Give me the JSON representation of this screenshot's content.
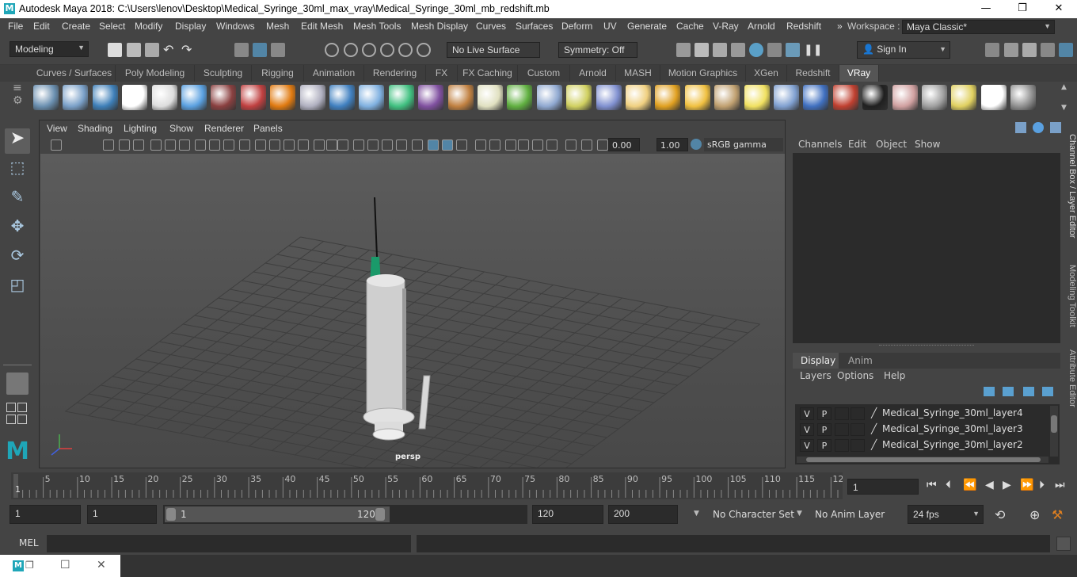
{
  "window": {
    "title": "Autodesk Maya 2018: C:\\Users\\lenov\\Desktop\\Medical_Syringe_30ml_max_vray\\Medical_Syringe_30ml_mb_redshift.mb",
    "logo": "M",
    "minimize": "—",
    "maximize": "❐",
    "close": "✕"
  },
  "menubar": {
    "items": [
      "File",
      "Edit",
      "Create",
      "Select",
      "Modify",
      "Display",
      "Windows",
      "Mesh",
      "Edit Mesh",
      "Mesh Tools",
      "Mesh Display",
      "Curves",
      "Surfaces",
      "Deform",
      "UV",
      "Generate",
      "Cache",
      "V-Ray",
      "Arnold",
      "Redshift"
    ],
    "more": "»",
    "workspace_label": "Workspace :",
    "workspace_value": "Maya Classic*"
  },
  "statusline": {
    "mode": "Modeling",
    "live_surface": "No Live Surface",
    "symmetry": "Symmetry: Off",
    "sign_in": "Sign In"
  },
  "shelf": {
    "tabs": [
      "Curves / Surfaces",
      "Poly Modeling",
      "Sculpting",
      "Rigging",
      "Animation",
      "Rendering",
      "FX",
      "FX Caching",
      "Custom",
      "Arnold",
      "MASH",
      "Motion Graphics",
      "XGen",
      "Redshift",
      "VRay"
    ],
    "active_tab": "VRay",
    "icon_colors": [
      "#6a8fb0",
      "#7aa0c8",
      "#3e7fb8",
      "#ffffff",
      "#dddddd",
      "#5aa0e0",
      "#8a4040",
      "#c04040",
      "#e07a10",
      "#b0b0c0",
      "#4080c0",
      "#7fb0e0",
      "#40c080",
      "#8050a0",
      "#c08040",
      "#e0e0c0",
      "#60b040",
      "#8fa8d0",
      "#d0d060",
      "#8090d0",
      "#f0d080",
      "#e0a020",
      "#f0c040",
      "#c0a070",
      "#f0e060",
      "#80a0d0",
      "#4070c0",
      "#c04030",
      "#202020",
      "#d0a0a0",
      "#a0a0a0",
      "#e0d060",
      "#ffffff",
      "#909090"
    ]
  },
  "viewport": {
    "menus": [
      "View",
      "Shading",
      "Lighting",
      "Show",
      "Renderer",
      "Panels"
    ],
    "exposure": "0.00",
    "gamma": "1.00",
    "color_space": "sRGB gamma",
    "camera_label": "persp"
  },
  "channelbox": {
    "menus": [
      "Channels",
      "Edit",
      "Object",
      "Show"
    ]
  },
  "layers": {
    "tabs": [
      "Display",
      "Anim"
    ],
    "menus": [
      "Layers",
      "Options",
      "Help"
    ],
    "rows": [
      {
        "v": "V",
        "p": "P",
        "name": "Medical_Syringe_30ml_layer4"
      },
      {
        "v": "V",
        "p": "P",
        "name": "Medical_Syringe_30ml_layer3"
      },
      {
        "v": "V",
        "p": "P",
        "name": "Medical_Syringe_30ml_layer2"
      }
    ]
  },
  "sidetabs": [
    "Channel Box / Layer Editor",
    "Modeling Toolkit",
    "Attribute Editor"
  ],
  "timeline": {
    "ticks": [
      "5",
      "10",
      "15",
      "20",
      "25",
      "30",
      "35",
      "40",
      "45",
      "50",
      "55",
      "60",
      "65",
      "70",
      "75",
      "80",
      "85",
      "90",
      "95",
      "100",
      "105",
      "110",
      "115",
      "12"
    ],
    "current_marker": "1",
    "current_frame": "1"
  },
  "range": {
    "start": "1",
    "playback_start": "1",
    "slider_start": "1",
    "slider_end": "120",
    "playback_end": "120",
    "end": "200",
    "character_set": "No Character Set",
    "anim_layer": "No Anim Layer",
    "fps": "24 fps"
  },
  "cmdline": {
    "label": "MEL"
  },
  "colors": {
    "bg": "#444444",
    "field": "#2b2b2b",
    "accent": "#5285a6",
    "vray_tab": "#555555"
  }
}
